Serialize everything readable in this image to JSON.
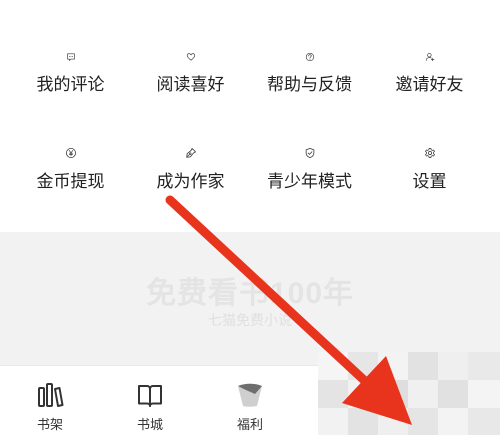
{
  "menu": {
    "row1": [
      {
        "label": "我的评论",
        "icon": "comment-icon"
      },
      {
        "label": "阅读喜好",
        "icon": "heart-icon"
      },
      {
        "label": "帮助与反馈",
        "icon": "help-icon"
      },
      {
        "label": "邀请好友",
        "icon": "add-user-icon"
      }
    ],
    "row2": [
      {
        "label": "金币提现",
        "icon": "coin-yen-icon"
      },
      {
        "label": "成为作家",
        "icon": "pen-icon"
      },
      {
        "label": "青少年模式",
        "icon": "shield-check-icon"
      },
      {
        "label": "设置",
        "icon": "gear-icon"
      }
    ]
  },
  "banner": {
    "title": "免费看书100年",
    "subtitle": "七猫免费小说"
  },
  "tabbar": {
    "items": [
      {
        "label": "书架",
        "icon": "bookshelf-icon"
      },
      {
        "label": "书城",
        "icon": "book-icon"
      },
      {
        "label": "福利",
        "icon": "welfare-icon"
      }
    ]
  },
  "colors": {
    "icon_stroke": "#333333",
    "annotation_arrow": "#e8341c",
    "banner_bg": "#f2f2f2"
  }
}
